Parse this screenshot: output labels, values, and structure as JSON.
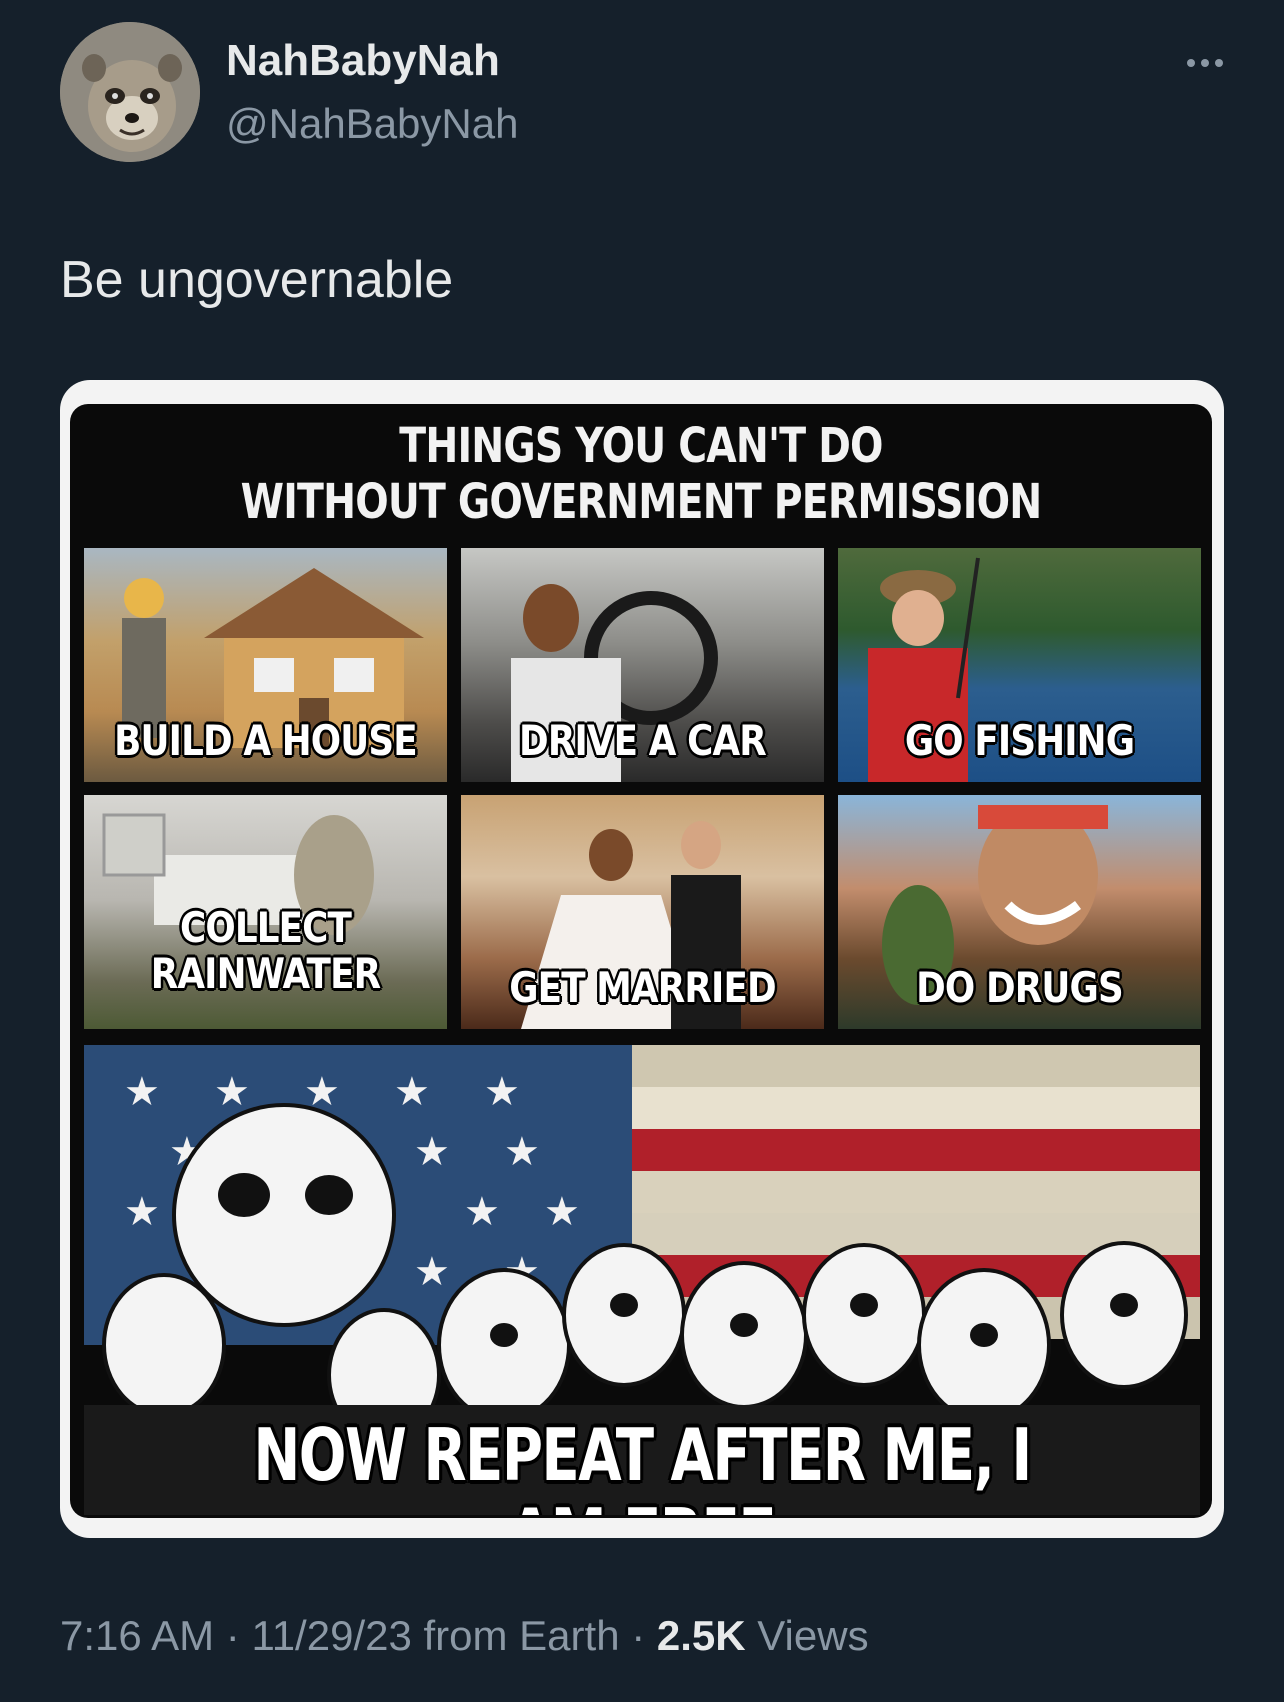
{
  "author": {
    "display_name": "NahBabyNah",
    "handle": "@NahBabyNah"
  },
  "tweet": {
    "text": "Be ungovernable"
  },
  "meme": {
    "title_line1": "THINGS YOU CAN'T DO",
    "title_line2": "WITHOUT GOVERNMENT PERMISSION",
    "panels": [
      {
        "caption": "BUILD A HOUSE"
      },
      {
        "caption": "DRIVE A CAR"
      },
      {
        "caption": "GO FISHING"
      },
      {
        "caption_line1": "COLLECT",
        "caption_line2": "RAINWATER"
      },
      {
        "caption": "GET MARRIED"
      },
      {
        "caption": "DO DRUGS"
      }
    ],
    "bottom_caption": "NOW REPEAT AFTER ME, I AM FREE"
  },
  "footer": {
    "time": "7:16 AM",
    "date": "11/29/23",
    "source": "from Earth",
    "separator": "·",
    "views_count": "2.5K",
    "views_label": "Views"
  },
  "colors": {
    "background": "#15202b",
    "text_primary": "#e7e9ea",
    "text_secondary": "#8b98a5"
  },
  "icons": {
    "more": "more-dots-icon"
  }
}
